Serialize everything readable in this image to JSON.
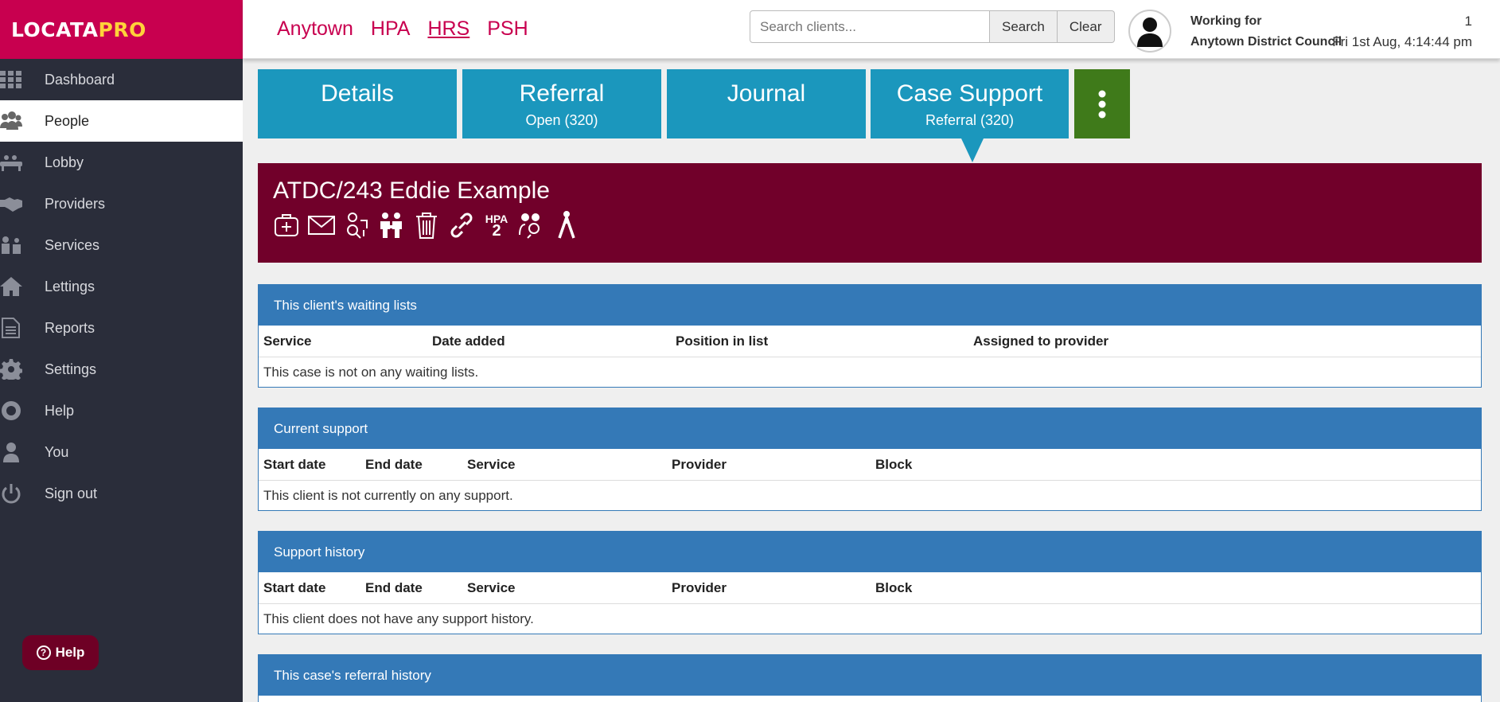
{
  "brand": {
    "logo_part1": "LOCATA",
    "logo_part2": "PRO"
  },
  "sidebar": {
    "items": [
      {
        "label": "Dashboard",
        "icon": "grid-icon"
      },
      {
        "label": "People",
        "icon": "people-icon"
      },
      {
        "label": "Lobby",
        "icon": "lobby-icon"
      },
      {
        "label": "Providers",
        "icon": "handshake-icon"
      },
      {
        "label": "Services",
        "icon": "services-icon"
      },
      {
        "label": "Lettings",
        "icon": "home-icon"
      },
      {
        "label": "Reports",
        "icon": "document-icon"
      },
      {
        "label": "Settings",
        "icon": "gear-icon"
      },
      {
        "label": "Help",
        "icon": "lifebuoy-icon"
      },
      {
        "label": "You",
        "icon": "user-icon"
      },
      {
        "label": "Sign out",
        "icon": "power-icon"
      }
    ],
    "active": "People",
    "help_button": "Help"
  },
  "header": {
    "links": [
      "Anytown",
      "HPA",
      "HRS",
      "PSH"
    ],
    "search_placeholder": "Search clients...",
    "search_button": "Search",
    "clear_button": "Clear",
    "working_for_label": "Working for",
    "council": "Anytown District Council",
    "count": "1",
    "datetime": "Fri 1st Aug, 4:14:44 pm"
  },
  "tabs": [
    {
      "title": "Details",
      "sub": ""
    },
    {
      "title": "Referral",
      "sub": "Open (320)"
    },
    {
      "title": "Journal",
      "sub": ""
    },
    {
      "title": "Case Support",
      "sub": "Referral (320)"
    }
  ],
  "client": {
    "title": "ATDC/243 Eddie Example",
    "hpa_label": "HPA",
    "hpa_number": "2"
  },
  "panels": {
    "waiting": {
      "title": "This client's waiting lists",
      "cols": [
        "Service",
        "Date added",
        "Position in list",
        "Assigned to provider"
      ],
      "empty": "This case is not on any waiting lists."
    },
    "current": {
      "title": "Current support",
      "cols": [
        "Start date",
        "End date",
        "Service",
        "Provider",
        "Block"
      ],
      "empty": "This client is not currently on any support."
    },
    "history": {
      "title": "Support history",
      "cols": [
        "Start date",
        "End date",
        "Service",
        "Provider",
        "Block"
      ],
      "empty": "This client does not have any support history."
    },
    "referral": {
      "title": "This case's referral history"
    }
  },
  "colors": {
    "brand": "#c8004f",
    "sidebar": "#2a2d3a",
    "tab": "#1b97bd",
    "banner": "#71002a",
    "panel": "#3479b7",
    "more": "#3f7a1a"
  }
}
